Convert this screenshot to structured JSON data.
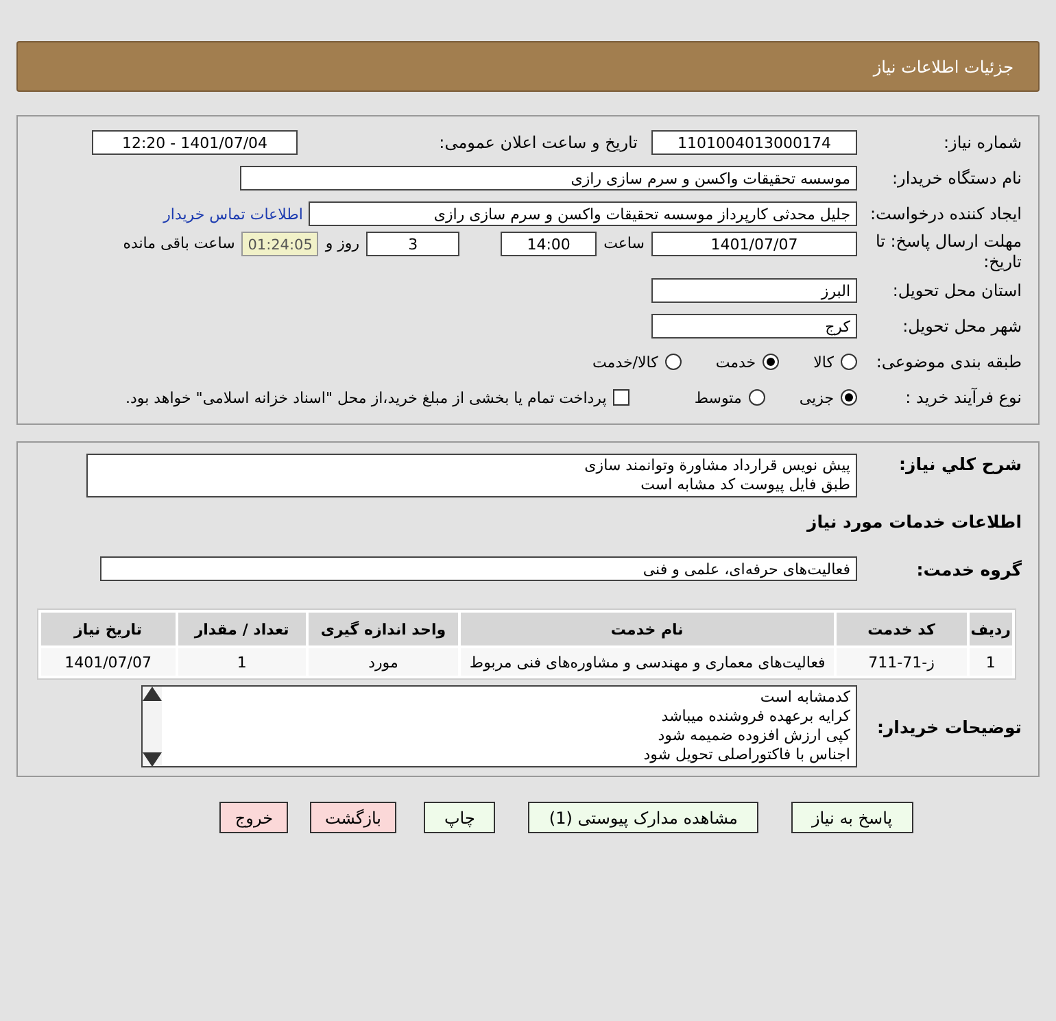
{
  "header": {
    "title": "جزئیات اطلاعات نیاز"
  },
  "details": {
    "need_number": {
      "label": "شماره نیاز:",
      "value": "1101004013000174"
    },
    "announce": {
      "label": "تاریخ و ساعت اعلان عمومی:",
      "value": "1401/07/04 - 12:20"
    },
    "buyer_org": {
      "label": "نام دستگاه خریدار:",
      "value": "موسسه تحقیقات واکسن و سرم سازی رازی"
    },
    "creator": {
      "label": "ایجاد کننده درخواست:",
      "value": "جلیل محدثی کارپرداز موسسه تحقیقات واکسن و سرم سازی رازی",
      "link": "اطلاعات تماس خریدار"
    },
    "deadline": {
      "label": "مهلت ارسال پاسخ: تا تاریخ:",
      "date": "1401/07/07",
      "time_label": "ساعت",
      "time": "14:00",
      "days": "3",
      "days_label": "روز و",
      "remaining": "01:24:05",
      "remaining_label": "ساعت باقی مانده"
    },
    "province": {
      "label": "استان محل تحویل:",
      "value": "البرز"
    },
    "city": {
      "label": "شهر محل تحویل:",
      "value": "کرج"
    },
    "category": {
      "label": "طبقه بندی موضوعی:",
      "options": [
        {
          "label": "کالا",
          "selected": false
        },
        {
          "label": "خدمت",
          "selected": true
        },
        {
          "label": "کالا/خدمت",
          "selected": false
        }
      ]
    },
    "process": {
      "label": "نوع فرآیند خرید :",
      "options": [
        {
          "label": "جزیی",
          "selected": true
        },
        {
          "label": "متوسط",
          "selected": false
        }
      ],
      "payment": {
        "label": "پرداخت تمام یا بخشی از مبلغ خرید،از محل \"اسناد خزانه اسلامی\" خواهد بود.",
        "checked": false
      }
    }
  },
  "services": {
    "description": {
      "label": "شرح کلي نياز:",
      "lines": [
        "پیش نویس قرارداد مشاورة وتوانمند سازی",
        "طبق فایل پیوست کد مشابه است"
      ]
    },
    "section_title": "اطلاعات خدمات مورد نیاز",
    "group": {
      "label": "گروه خدمت:",
      "value": "فعالیت‌های حرفه‌ای، علمی و فنی"
    },
    "table": {
      "columns": [
        "ردیف",
        "کد خدمت",
        "نام خدمت",
        "واحد اندازه گیری",
        "تعداد / مقدار",
        "تاریخ نیاز"
      ],
      "rows": [
        [
          "1",
          "ز-71-711",
          "فعالیت‌های معماری و مهندسی و مشاوره‌های فنی مربوط",
          "مورد",
          "1",
          "1401/07/07"
        ]
      ]
    },
    "buyer_notes": {
      "label": "توضیحات خریدار:",
      "lines": [
        "کدمشابه است",
        "کرایه برعهده فروشنده میباشد",
        "کپی ارزش افزوده ضمیمه شود",
        "اجناس با فاکتوراصلی تحویل شود"
      ]
    }
  },
  "buttons": [
    {
      "label": "پاسخ به نیاز",
      "kind": "primary"
    },
    {
      "label": "مشاهده مدارک پیوستی (1)",
      "kind": "primary"
    },
    {
      "label": "چاپ",
      "kind": "primary"
    },
    {
      "label": "بازگشت",
      "kind": "danger"
    },
    {
      "label": "خروج",
      "kind": "danger"
    }
  ]
}
